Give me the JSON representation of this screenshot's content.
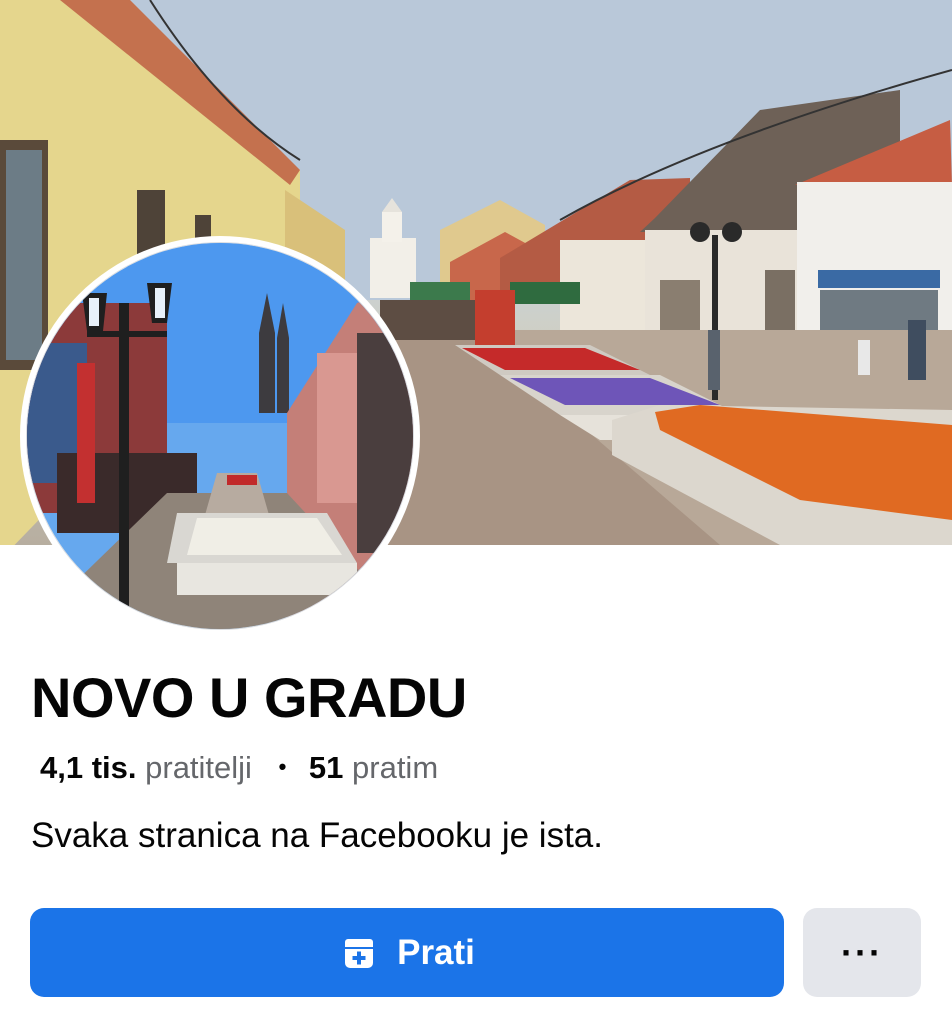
{
  "profile": {
    "name": "NOVO U GRADU",
    "followers_count": "4,1 tis.",
    "followers_label": "pratitelji",
    "separator": "•",
    "following_count": "51",
    "following_label": "pratim",
    "bio": "Svaka stranica na Facebooku je ista."
  },
  "actions": {
    "follow_label": "Prati",
    "follow_icon": "follow-page-icon",
    "more_label": "···",
    "more_icon": "more-options-icon"
  },
  "colors": {
    "accent": "#1b74e8",
    "secondary_button": "#e4e6eb",
    "muted_text": "#65676b"
  }
}
